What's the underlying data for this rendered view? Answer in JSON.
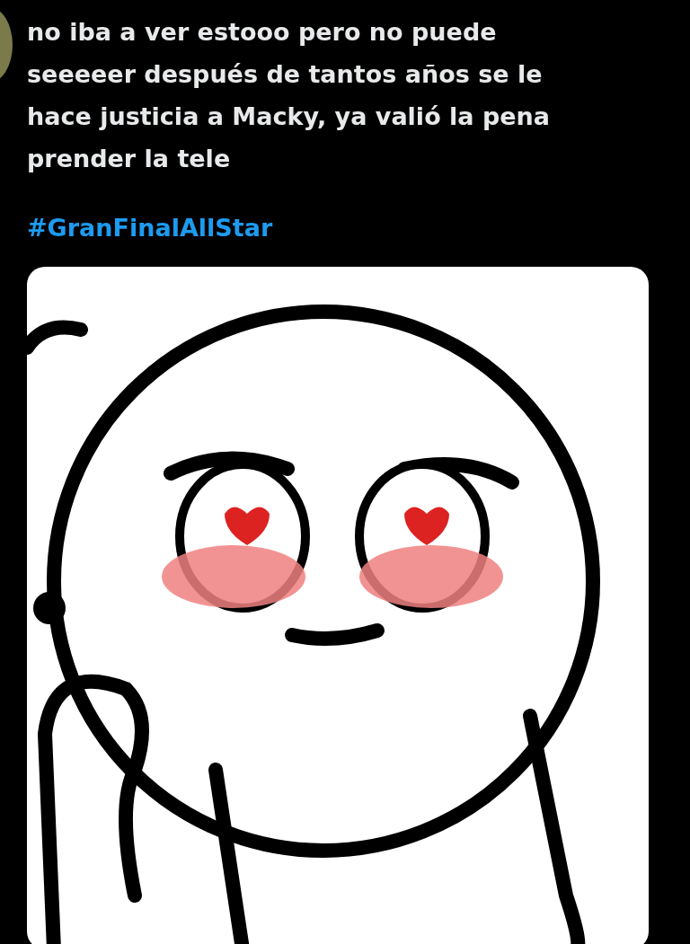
{
  "tweet": {
    "text": "no iba a ver estooo pero no puede seeeeer después de tantos años se le hace justicia a Macky, ya valió la pena prender la tele",
    "hashtag": "#GranFinalAllStar"
  }
}
